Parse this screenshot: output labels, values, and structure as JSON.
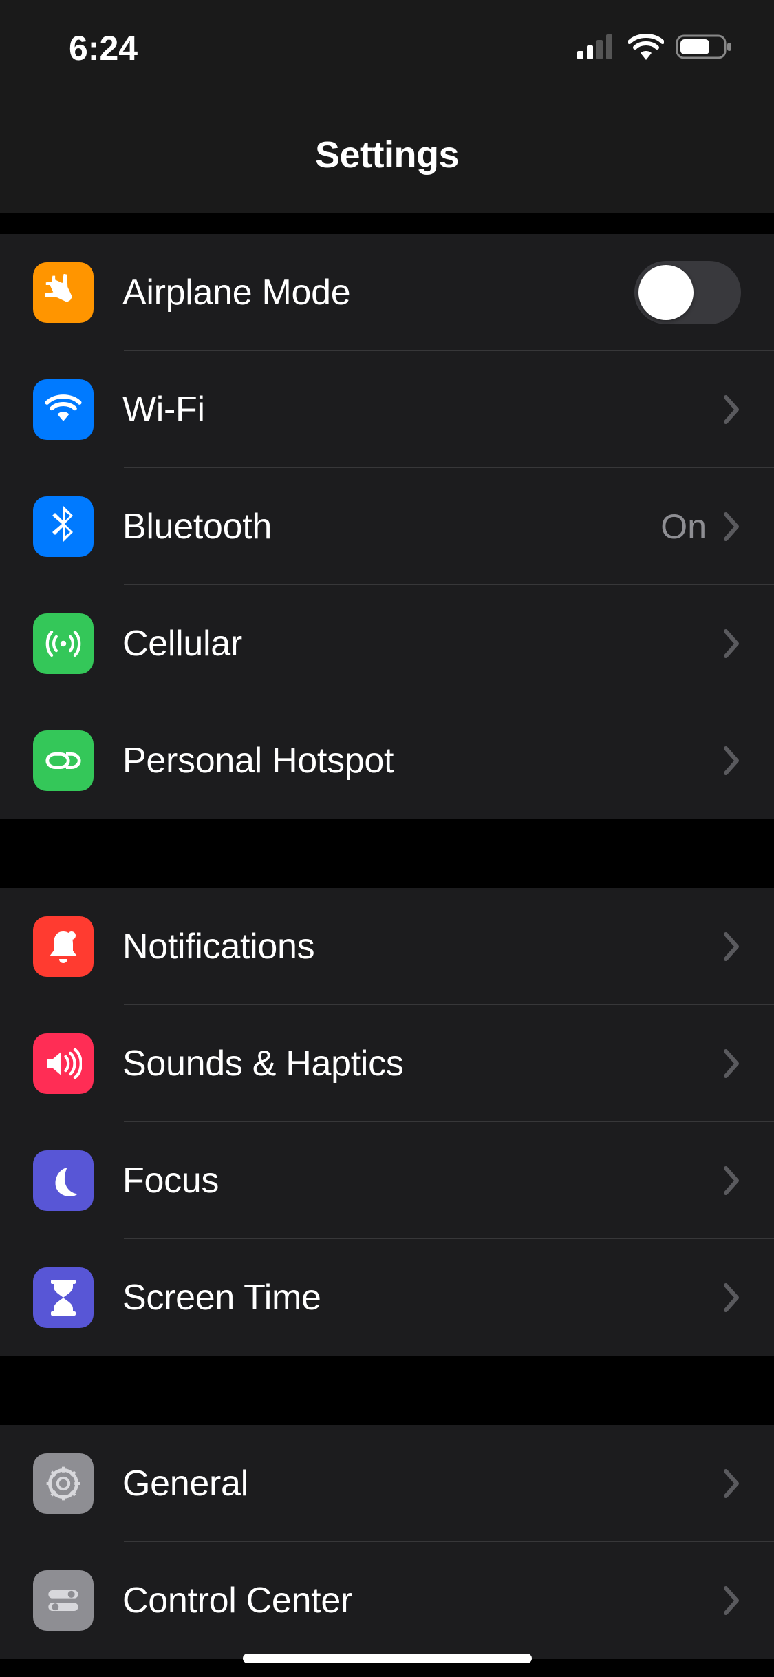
{
  "status_bar": {
    "time": "6:24"
  },
  "header": {
    "title": "Settings"
  },
  "groups": [
    {
      "rows": [
        {
          "id": "airplane",
          "label": "Airplane Mode",
          "icon": "airplane-icon",
          "icon_color": "#ff9500",
          "control": "toggle",
          "toggle_on": false
        },
        {
          "id": "wifi",
          "label": "Wi-Fi",
          "icon": "wifi-icon",
          "icon_color": "#007aff",
          "control": "disclosure",
          "value": ""
        },
        {
          "id": "bluetooth",
          "label": "Bluetooth",
          "icon": "bluetooth-icon",
          "icon_color": "#007aff",
          "control": "disclosure",
          "value": "On"
        },
        {
          "id": "cellular",
          "label": "Cellular",
          "icon": "antenna-icon",
          "icon_color": "#34c759",
          "control": "disclosure",
          "value": ""
        },
        {
          "id": "hotspot",
          "label": "Personal Hotspot",
          "icon": "link-icon",
          "icon_color": "#34c759",
          "control": "disclosure",
          "value": ""
        }
      ]
    },
    {
      "rows": [
        {
          "id": "notifications",
          "label": "Notifications",
          "icon": "bell-icon",
          "icon_color": "#ff3b30",
          "control": "disclosure",
          "value": ""
        },
        {
          "id": "sounds",
          "label": "Sounds & Haptics",
          "icon": "speaker-icon",
          "icon_color": "#ff2d55",
          "control": "disclosure",
          "value": ""
        },
        {
          "id": "focus",
          "label": "Focus",
          "icon": "moon-icon",
          "icon_color": "#5856d6",
          "control": "disclosure",
          "value": ""
        },
        {
          "id": "screentime",
          "label": "Screen Time",
          "icon": "hourglass-icon",
          "icon_color": "#5856d6",
          "control": "disclosure",
          "value": ""
        }
      ]
    },
    {
      "rows": [
        {
          "id": "general",
          "label": "General",
          "icon": "gear-icon",
          "icon_color": "#8e8e93",
          "control": "disclosure",
          "value": ""
        },
        {
          "id": "controlcenter",
          "label": "Control Center",
          "icon": "sliders-icon",
          "icon_color": "#8e8e93",
          "control": "disclosure",
          "value": ""
        }
      ]
    }
  ]
}
